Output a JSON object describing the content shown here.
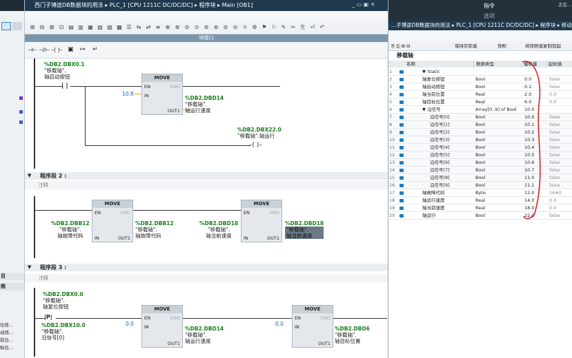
{
  "editor_title": "西门子博途DB数据块的用法 ▸ PLC_1 [CPU 1211C DC/DC/DC] ▸ 程序块 ▸ Main [OB1]",
  "block_interface_label": "块接口",
  "right_header": "指令",
  "right_sub": "选项",
  "right_top_text": "正在…",
  "db_title": "...子博途DB数据块的用法 ▸ PLC_1 [CPU 1211C DC/DC/DC] ▸ 程序块 ▸ 移动轴",
  "db_toolbar": [
    "保持实际值",
    "快照",
    "将快照值复制到起"
  ],
  "db_name": "移载轴",
  "columns": [
    "名称",
    "数据类型",
    "偏移量",
    "起始值"
  ],
  "rows": [
    {
      "n": "1",
      "name": "▼ Static",
      "type": "",
      "off": "",
      "start": ""
    },
    {
      "n": "2",
      "name": "轴复位按钮",
      "type": "Bool",
      "off": "0.0",
      "start": "false"
    },
    {
      "n": "3",
      "name": "轴启动按钮",
      "type": "Bool",
      "off": "0.1",
      "start": "false"
    },
    {
      "n": "4",
      "name": "轴当前位置",
      "type": "Real",
      "off": "2.0",
      "start": "0.0"
    },
    {
      "n": "5",
      "name": "轴目标位置",
      "type": "Real",
      "off": "6.0",
      "start": "0.0"
    },
    {
      "n": "6",
      "name": "▼ 沿信号",
      "type": "Array[0..9] of Bool",
      "off": "10.0",
      "start": ""
    },
    {
      "n": "7",
      "name": "沿信号[0]",
      "type": "Bool",
      "off": "10.0",
      "start": "false"
    },
    {
      "n": "8",
      "name": "沿信号[1]",
      "type": "Bool",
      "off": "10.1",
      "start": "false"
    },
    {
      "n": "9",
      "name": "沿信号[2]",
      "type": "Bool",
      "off": "10.2",
      "start": "false"
    },
    {
      "n": "10",
      "name": "沿信号[3]",
      "type": "Bool",
      "off": "10.3",
      "start": "false"
    },
    {
      "n": "11",
      "name": "沿信号[4]",
      "type": "Bool",
      "off": "10.4",
      "start": "false"
    },
    {
      "n": "12",
      "name": "沿信号[5]",
      "type": "Bool",
      "off": "10.5",
      "start": "false"
    },
    {
      "n": "13",
      "name": "沿信号[6]",
      "type": "Bool",
      "off": "10.6",
      "start": "false"
    },
    {
      "n": "14",
      "name": "沿信号[7]",
      "type": "Bool",
      "off": "10.7",
      "start": "false"
    },
    {
      "n": "15",
      "name": "沿信号[8]",
      "type": "Bool",
      "off": "11.0",
      "start": "false"
    },
    {
      "n": "16",
      "name": "沿信号[9]",
      "type": "Bool",
      "off": "11.1",
      "start": "false"
    },
    {
      "n": "17",
      "name": "轴故障代码",
      "type": "Byte",
      "off": "12.0",
      "start": "16#0"
    },
    {
      "n": "18",
      "name": "轴运行速度",
      "type": "Real",
      "off": "14.0",
      "start": "0.0"
    },
    {
      "n": "19",
      "name": "轴当前速度",
      "type": "Real",
      "off": "18.0",
      "start": "0.0"
    },
    {
      "n": "20",
      "name": "轴运行",
      "type": "Bool",
      "off": "22.0",
      "start": "false"
    }
  ],
  "seg1": {
    "contact_addr": "%DB2.DBX0.1",
    "contact_db": "\"移载轴\".",
    "contact_name": "轴启动按钮",
    "move_title": "MOVE",
    "in_val": "10.8",
    "out_addr": "%DB2.DBD14",
    "out_db": "\"移载轴\".",
    "out_name": "轴运行速度",
    "coil_addr": "%DB2.DBX22.0",
    "coil_name": "\"移载轴\".轴运行"
  },
  "seg2": {
    "header": "程序段 2 :",
    "comment": "注释",
    "m1_in_addr": "%DB2.DBB12",
    "m1_in_db": "\"移载轴\".",
    "m1_in_name": "轴故障代码",
    "m1_out_addr": "%DB2.DBB12",
    "m1_out_db": "\"移载轴\".",
    "m1_out_name": "轴故障代码",
    "m2_in_addr": "%DB2.DBD18",
    "m2_in_db": "\"移载轴\".",
    "m2_in_name": "轴当前速度",
    "m2_out_addr": "%DB2.DBD18",
    "m2_out_db": "\"移载轴\".",
    "m2_out_name": "轴当前速度"
  },
  "seg3": {
    "header": "程序段 3 :",
    "comment": "注释",
    "c1_addr": "%DB2.DBX0.0",
    "c1_db": "\"移载轴\".",
    "c1_name": "轴复位按钮",
    "c2_addr": "%DB2.DBX10.0",
    "c2_db": "\"移载轴\".",
    "c2_name": "沿信号[0]",
    "m1_in_val": "0.0",
    "m1_out_addr": "%DB2.DBD14",
    "m1_out_db": "\"移载轴\".",
    "m1_out_name": "轴运行速度",
    "m2_in_val": "0.0",
    "m2_out_addr": "%DB2.DBD6",
    "m2_out_db": "\"移载轴\".",
    "m2_out_name": "轴目标位置"
  },
  "pins": {
    "en": "EN",
    "eno": "ENO",
    "in": "IN",
    "out": "OUT1"
  },
  "left_labels": [
    "目",
    "图",
    "位技...",
    "动找...",
    "前位...",
    "标位..."
  ],
  "accent_red": "#e02020"
}
